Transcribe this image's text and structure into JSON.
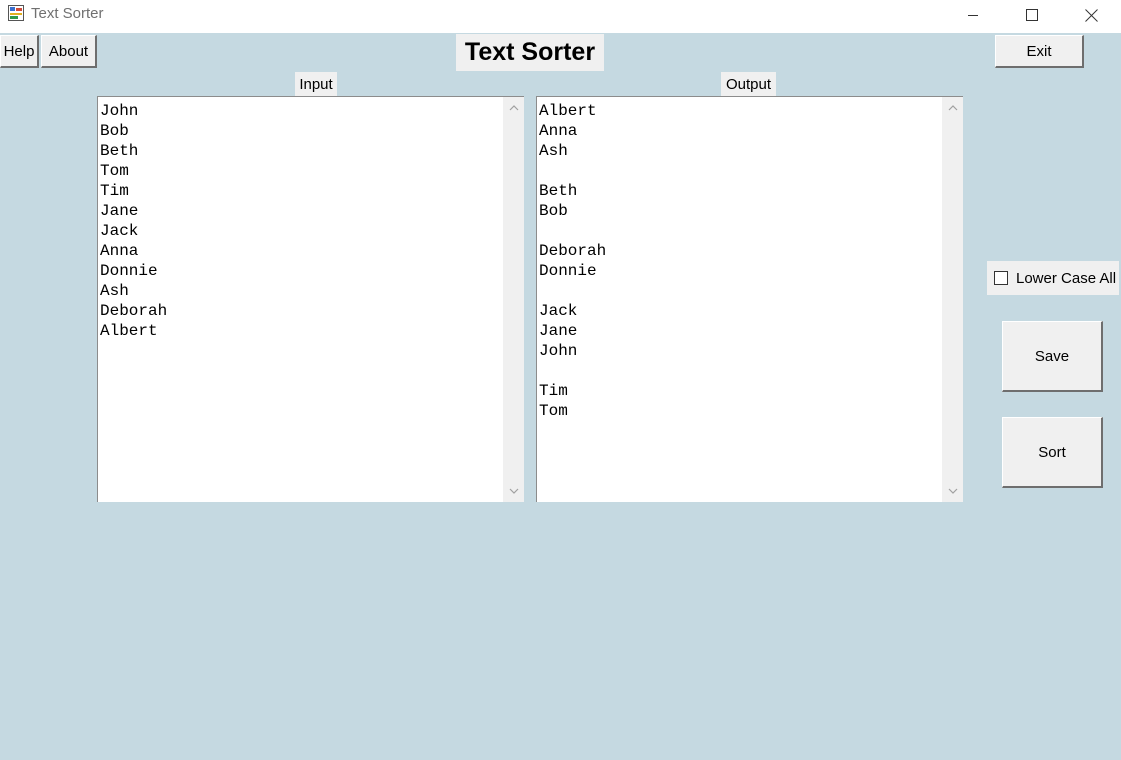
{
  "window": {
    "title": "Text Sorter",
    "minimize_icon": "minimize-icon",
    "maximize_icon": "maximize-icon",
    "close_icon": "close-icon"
  },
  "toolbar": {
    "help_label": "Help",
    "about_label": "About",
    "exit_label": "Exit"
  },
  "heading": "Text Sorter",
  "input": {
    "label": "Input",
    "text": "John\nBob\nBeth\nTom\nTim\nJane\nJack\nAnna\nDonnie\nAsh\nDeborah\nAlbert"
  },
  "output": {
    "label": "Output",
    "text": "Albert\nAnna\nAsh\n\nBeth\nBob\n\nDeborah\nDonnie\n\nJack\nJane\nJohn\n\nTim\nTom"
  },
  "options": {
    "lower_case_all_label": "Lower Case All",
    "lower_case_all_checked": false
  },
  "actions": {
    "save_label": "Save",
    "sort_label": "Sort"
  },
  "colors": {
    "background": "#c5d9e1",
    "control_face": "#f0f0f0"
  }
}
